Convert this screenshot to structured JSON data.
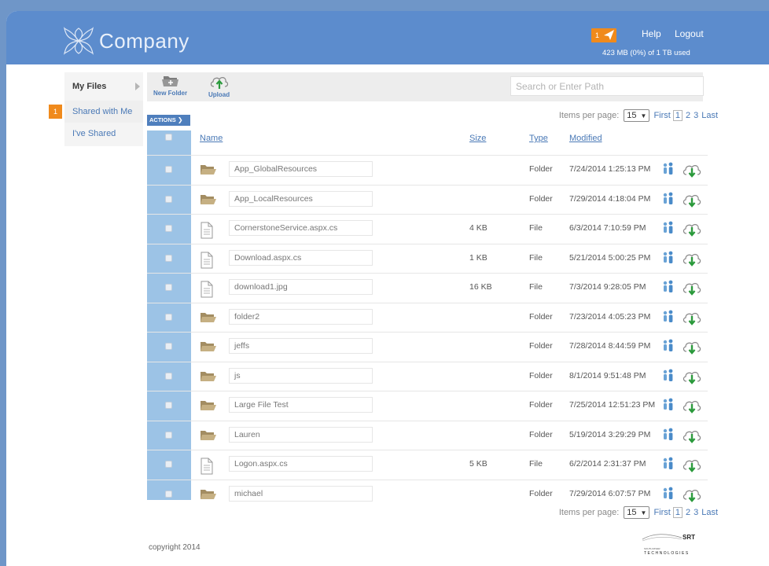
{
  "header": {
    "logo_text": "Company",
    "notification_count": "1",
    "help_label": "Help",
    "logout_label": "Logout",
    "quota_text": "423 MB (0%) of 1 TB used"
  },
  "sidebar": {
    "items": [
      {
        "label": "My Files"
      },
      {
        "label": "Shared with Me",
        "badge": "1"
      },
      {
        "label": "I've Shared"
      }
    ]
  },
  "toolbar": {
    "new_folder_label": "New Folder",
    "upload_label": "Upload",
    "search_placeholder": "Search or Enter Path"
  },
  "actions_label": "ACTIONS",
  "pager": {
    "label": "Items per page:",
    "per_page": "15",
    "first": "First",
    "pages": [
      "1",
      "2",
      "3"
    ],
    "last": "Last"
  },
  "table": {
    "columns": {
      "name": "Name",
      "size": "Size",
      "type": "Type",
      "modified": "Modified"
    },
    "rows": [
      {
        "name": "App_GlobalResources",
        "size": "",
        "type": "Folder",
        "modified": "7/24/2014 1:25:13 PM",
        "icon": "folder-icon"
      },
      {
        "name": "App_LocalResources",
        "size": "",
        "type": "Folder",
        "modified": "7/29/2014 4:18:04 PM",
        "icon": "folder-icon"
      },
      {
        "name": "CornerstoneService.aspx.cs",
        "size": "4 KB",
        "type": "File",
        "modified": "6/3/2014 7:10:59 PM",
        "icon": "file-icon"
      },
      {
        "name": "Download.aspx.cs",
        "size": "1 KB",
        "type": "File",
        "modified": "5/21/2014 5:00:25 PM",
        "icon": "file-icon"
      },
      {
        "name": "download1.jpg",
        "size": "16 KB",
        "type": "File",
        "modified": "7/3/2014 9:28:05 PM",
        "icon": "file-icon"
      },
      {
        "name": "folder2",
        "size": "",
        "type": "Folder",
        "modified": "7/23/2014 4:05:23 PM",
        "icon": "folder-icon"
      },
      {
        "name": "jeffs",
        "size": "",
        "type": "Folder",
        "modified": "7/28/2014 8:44:59 PM",
        "icon": "folder-icon"
      },
      {
        "name": "js",
        "size": "",
        "type": "Folder",
        "modified": "8/1/2014 9:51:48 PM",
        "icon": "folder-icon"
      },
      {
        "name": "Large File Test",
        "size": "",
        "type": "Folder",
        "modified": "7/25/2014 12:51:23 PM",
        "icon": "folder-icon"
      },
      {
        "name": "Lauren",
        "size": "",
        "type": "Folder",
        "modified": "5/19/2014 3:29:29 PM",
        "icon": "folder-icon"
      },
      {
        "name": "Logon.aspx.cs",
        "size": "5 KB",
        "type": "File",
        "modified": "6/2/2014 2:31:37 PM",
        "icon": "file-icon"
      },
      {
        "name": "michael",
        "size": "",
        "type": "Folder",
        "modified": "7/29/2014 6:07:57 PM",
        "icon": "folder-icon"
      }
    ]
  },
  "footer": {
    "copyright": "copyright 2014",
    "brand_short": "SRT",
    "brand_small": "SOUTH RIVER",
    "brand_long": "TECHNOLOGIES"
  },
  "colors": {
    "header_bg": "#5c8ccd",
    "accent_orange": "#f08a1c",
    "link_blue": "#4a79b6",
    "checkbox_column": "#9cc3e6"
  }
}
